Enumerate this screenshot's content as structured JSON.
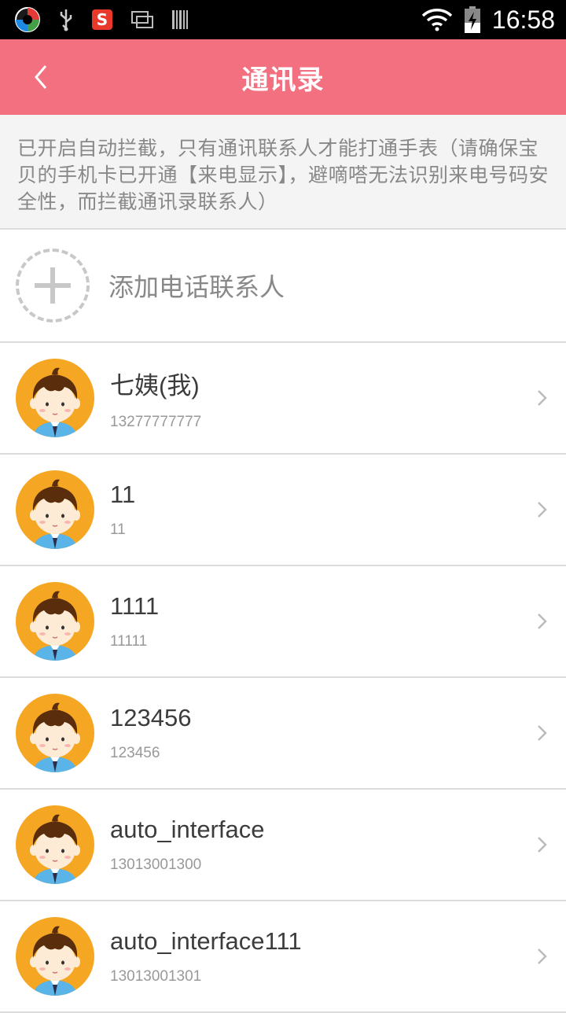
{
  "status_bar": {
    "time": "16:58",
    "icons": [
      "app-logo-icon",
      "usb-icon",
      "sogou-icon",
      "screen-icon",
      "barcode-icon",
      "wifi-icon",
      "battery-charging-icon"
    ]
  },
  "header": {
    "title": "通讯录",
    "back_icon": "chevron-left-icon",
    "color": "#f2707f"
  },
  "notice": {
    "text": "已开启自动拦截，只有通讯联系人才能打通手表（请确保宝贝的手机卡已开通【来电显示】，避嘀嗒无法识别来电号码安全性，而拦截通讯录联系人）"
  },
  "add_contact": {
    "label": "添加电话联系人",
    "icon": "add-circle-icon"
  },
  "contacts": [
    {
      "name": "七姨(我)",
      "phone": "13277777777"
    },
    {
      "name": "11",
      "phone": "11"
    },
    {
      "name": "1111",
      "phone": "11111"
    },
    {
      "name": "123456",
      "phone": "123456"
    },
    {
      "name": "auto_interface",
      "phone": "13013001300"
    },
    {
      "name": "auto_interface111",
      "phone": "13013001301"
    }
  ]
}
